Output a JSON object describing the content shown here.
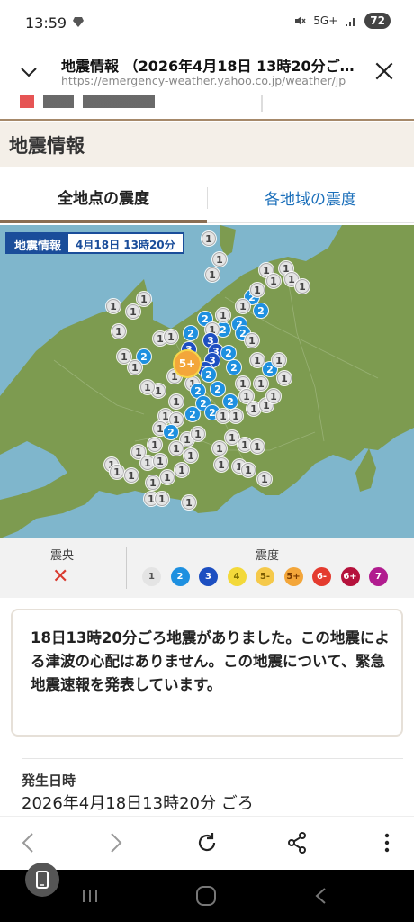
{
  "status": {
    "time": "13:59",
    "network": "5G+",
    "battery": "72"
  },
  "url_bar": {
    "title": "地震情報 （2026年4月18日 13時20分ご…",
    "url": "https://emergency-weather.yahoo.co.jp/weather/jp"
  },
  "section": {
    "title": "地震情報"
  },
  "tabs": {
    "active": "全地点の震度",
    "inactive": "各地域の震度"
  },
  "map": {
    "label_title": "地震情報",
    "label_date": "4月18日 13時20分",
    "epicenter_label": "5+"
  },
  "legend": {
    "epicenter_label": "震央",
    "epicenter_mark": "✕",
    "intensity_label": "震度",
    "levels": [
      {
        "label": "1",
        "color": "#e4e4e4",
        "text": "#555"
      },
      {
        "label": "2",
        "color": "#1e90e0",
        "text": "#fff"
      },
      {
        "label": "3",
        "color": "#1d4fc1",
        "text": "#fff"
      },
      {
        "label": "4",
        "color": "#f3d93a",
        "text": "#7a6a00"
      },
      {
        "label": "5-",
        "color": "#f5c94a",
        "text": "#7a5a00"
      },
      {
        "label": "5+",
        "color": "#f3a63a",
        "text": "#7a3a00"
      },
      {
        "label": "6-",
        "color": "#e43b2f",
        "text": "#fff"
      },
      {
        "label": "6+",
        "color": "#b5123c",
        "text": "#fff"
      },
      {
        "label": "7",
        "color": "#b11c8f",
        "text": "#fff"
      }
    ]
  },
  "notice": {
    "text": "18日13時20分ごろ地震がありました。この地震による津波の心配はありません。この地震について、緊急地震速報を発表しています。"
  },
  "occurrence": {
    "label": "発生日時",
    "value": "2026年4月18日13時20分 ごろ"
  },
  "colors": {
    "accent": "#8a6e54",
    "link": "#1b6fba",
    "land": "#7d9b50",
    "sea": "#7fb6cc"
  },
  "icons": [
    "chevron-down-icon",
    "close-icon",
    "back-icon",
    "forward-icon",
    "reload-icon",
    "share-icon",
    "more-icon"
  ]
}
